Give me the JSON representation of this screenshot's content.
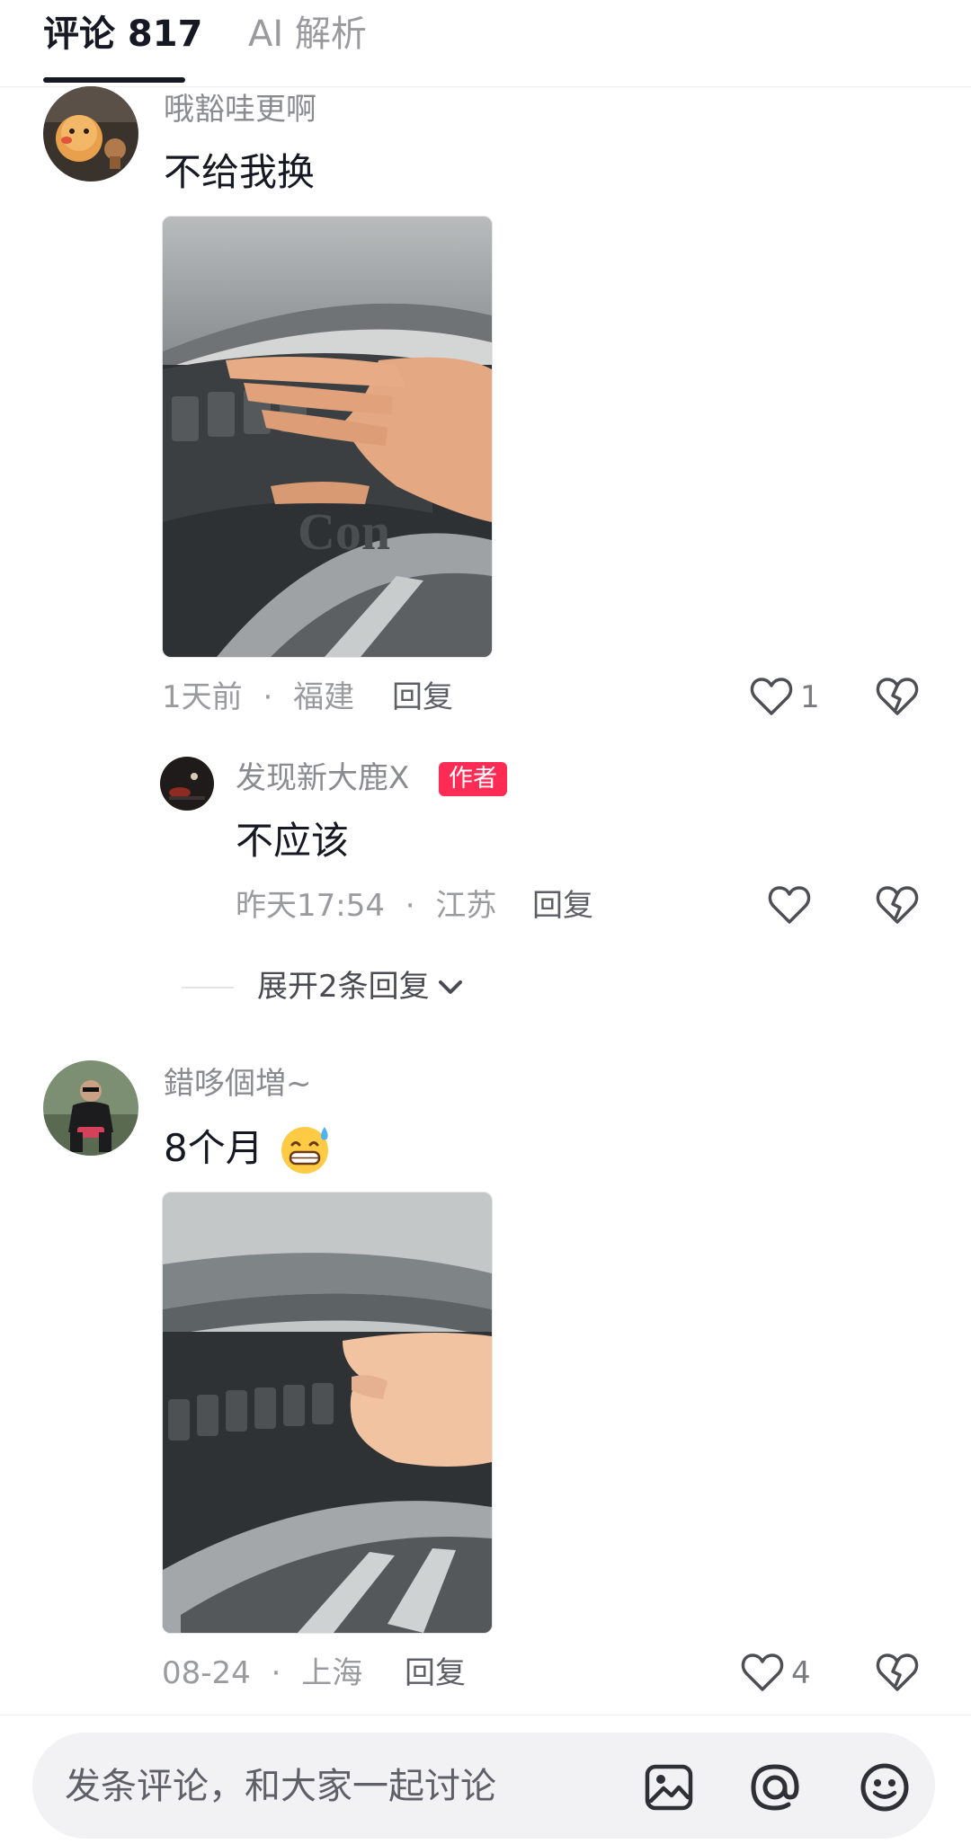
{
  "tabs": [
    {
      "label": "评论 817",
      "active": true
    },
    {
      "label": "AI 解析",
      "active": false
    }
  ],
  "comments": [
    {
      "username": "哦豁哇更啊",
      "text": "不给我换",
      "time": "1天前",
      "location": "福建",
      "reply_label": "回复",
      "likes": "1",
      "avatar_icon": "chick-avatar"
    },
    {
      "username": "錯哆個増~",
      "text": "8个月",
      "emoji": "😅",
      "time": "08-24",
      "location": "上海",
      "reply_label": "回复",
      "likes": "4",
      "avatar_icon": "person-avatar"
    }
  ],
  "reply": {
    "username": "发现新大鹿X",
    "badge": "作者",
    "text": "不应该",
    "time": "昨天17:54",
    "location": "江苏",
    "reply_label": "回复"
  },
  "expand_label": "展开2条回复",
  "separator": "·",
  "input": {
    "placeholder": "发条评论，和大家一起讨论"
  },
  "colors": {
    "accent": "#fe2c55",
    "text": "#161823",
    "muted": "#8a8b91"
  }
}
